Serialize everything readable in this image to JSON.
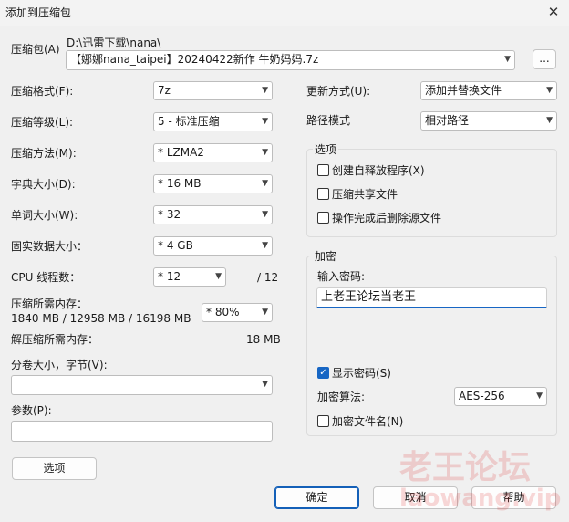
{
  "window": {
    "title": "添加到压缩包",
    "close_glyph": "✕"
  },
  "archive": {
    "label": "压缩包(A)",
    "path": "D:\\迅雷下载\\nana\\",
    "filename": "【娜娜nana_taipei】20240422新作 牛奶妈妈.7z",
    "browse_label": "..."
  },
  "left": {
    "format": {
      "label": "压缩格式(F):",
      "value": "7z"
    },
    "level": {
      "label": "压缩等级(L):",
      "value": "5 - 标准压缩"
    },
    "method": {
      "label": "压缩方法(M):",
      "value": "*  LZMA2"
    },
    "dict": {
      "label": "字典大小(D):",
      "value": "*  16 MB"
    },
    "word": {
      "label": "单词大小(W):",
      "value": "*  32"
    },
    "solid": {
      "label": "固实数据大小：",
      "value": "*  4 GB"
    },
    "threads": {
      "label": "CPU 线程数：",
      "value": "*  12",
      "max": "/ 12"
    },
    "memory": {
      "label": "压缩所需内存：",
      "detail": "1840 MB / 12958 MB / 16198 MB",
      "percent": "* 80%"
    },
    "decompress": {
      "label": "解压缩所需内存：",
      "value": "18 MB"
    },
    "split": {
      "label": "分卷大小，字节(V):",
      "value": ""
    },
    "params": {
      "label": "参数(P):",
      "value": ""
    },
    "options_button": "选项"
  },
  "right": {
    "update": {
      "label": "更新方式(U):",
      "value": "添加并替换文件"
    },
    "path_mode": {
      "label": "路径模式",
      "value": "相对路径"
    },
    "options_group": {
      "title": "选项",
      "items": [
        {
          "label": "创建自释放程序(X)",
          "checked": false
        },
        {
          "label": "压缩共享文件",
          "checked": false
        },
        {
          "label": "操作完成后删除源文件",
          "checked": false
        }
      ]
    },
    "encryption": {
      "title": "加密",
      "password_label": "输入密码:",
      "password_value": "上老王论坛当老王",
      "show_password": {
        "label": "显示密码(S)",
        "checked": true
      },
      "method_label": "加密算法:",
      "method_value": "AES-256",
      "encrypt_names": {
        "label": "加密文件名(N)",
        "checked": false
      }
    }
  },
  "footer": {
    "ok": "确定",
    "cancel": "取消",
    "help": "帮助"
  },
  "watermark": {
    "line1": "老王论坛",
    "line2": "laowang.vip"
  },
  "icons": {
    "chevron": "chevron-down-icon",
    "check": "check-icon",
    "close": "close-icon"
  },
  "colors": {
    "accent": "#1766c4",
    "watermark": "#dc2828"
  }
}
